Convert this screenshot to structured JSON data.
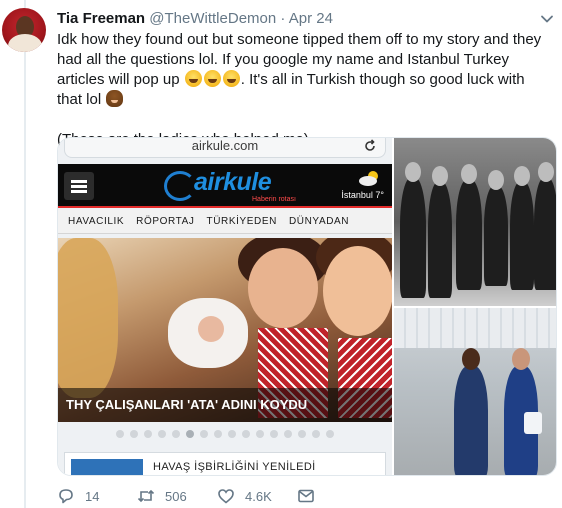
{
  "tweet": {
    "author_name": "Tia Freeman",
    "author_handle": "@TheWittleDemon",
    "separator": "·",
    "date": "Apr 24",
    "text_line1": "Idk how they found out but someone tipped them off to my story and they had all the questions lol. If you google my name and Istanbul Turkey articles will pop up ",
    "text_line1_tail": ". It's all in Turkish though so good luck with that lol ",
    "text_line2": "(These are the ladies who helped me)"
  },
  "media": {
    "url": "airkule.com",
    "logo": "airkule",
    "slogan": "Haberin rotası",
    "weather": "İstanbul 7°",
    "nav": [
      "HAVACILIK",
      "RÖPORTAJ",
      "TÜRKİYEDEN",
      "DÜNYADAN"
    ],
    "headline": "THY ÇALIŞANLARI 'ATA' ADINI KOYDU",
    "news_title": "HAVAŞ İŞBİRLİĞİNİ YENİLEDİ",
    "carousel_count": 16,
    "carousel_active": 5
  },
  "actions": {
    "replies": "14",
    "retweets": "506",
    "likes": "4.6K"
  },
  "colors": {
    "text": "#14171a",
    "muted": "#657786",
    "brand_blue": "#1f8fe0",
    "brand_red": "#e32b2b"
  },
  "icons": [
    "caret-down-icon",
    "reply-icon",
    "retweet-icon",
    "like-icon",
    "message-icon",
    "reload-icon",
    "menu-icon",
    "weather-cloud-icon"
  ]
}
